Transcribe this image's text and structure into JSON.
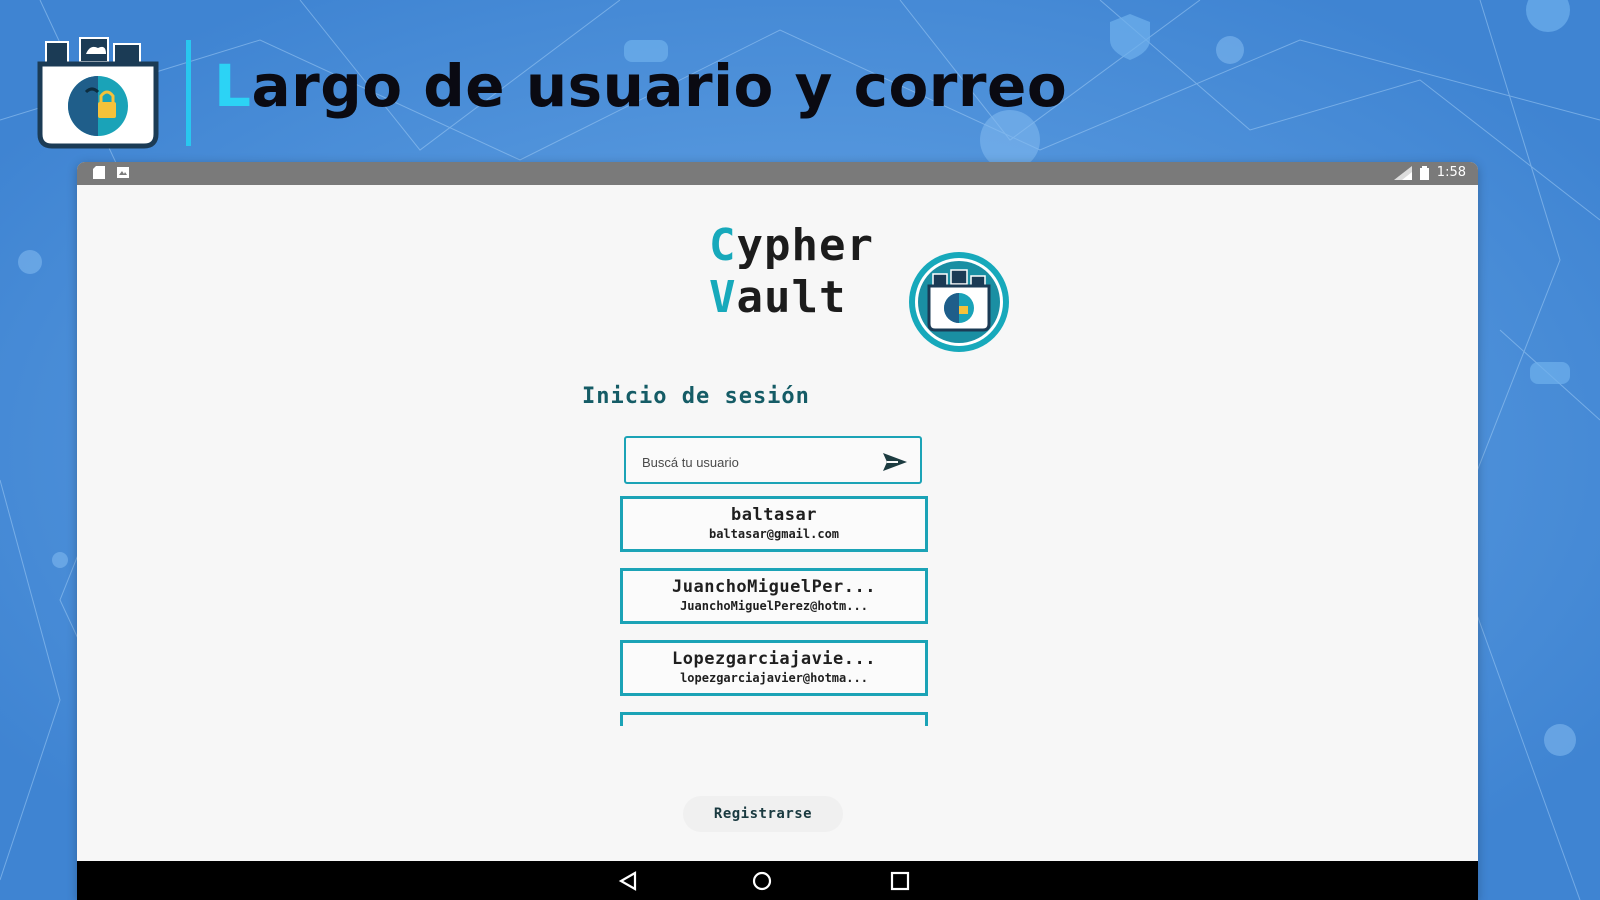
{
  "slide": {
    "title_first_letter": "L",
    "title_rest": "argo de usuario y correo",
    "brand_logo_icon": "folder-lock-face-icon"
  },
  "status_bar": {
    "left_icons": [
      "sd-card-icon",
      "image-notification-icon"
    ],
    "right_icons": [
      "signal-icon",
      "battery-icon"
    ],
    "time": "1:58"
  },
  "app": {
    "logo": {
      "line1_accent": "C",
      "line1_rest": "ypher",
      "line2_accent": "V",
      "line2_rest": "ault",
      "accent_color": "#17a9bb"
    },
    "heading": "Inicio de sesión",
    "search": {
      "placeholder": "Buscá tu usuario",
      "value": "",
      "send_icon": "send-arrow-icon"
    },
    "users": [
      {
        "name": "baltasar",
        "email": "baltasar@gmail.com"
      },
      {
        "name": "JuanchoMiguelPer...",
        "email": "JuanchoMiguelPerez@hotm..."
      },
      {
        "name": "Lopezgarciajavie...",
        "email": "lopezgarciajavier@hotma..."
      }
    ],
    "register_label": "Registrarse"
  },
  "nav": {
    "buttons": [
      "back-triangle-icon",
      "home-circle-icon",
      "recents-square-icon"
    ]
  },
  "colors": {
    "background": "#4a8fd9",
    "title_accent": "#2cd3f5",
    "card_border": "#1ba3b6",
    "heading": "#155c66"
  }
}
